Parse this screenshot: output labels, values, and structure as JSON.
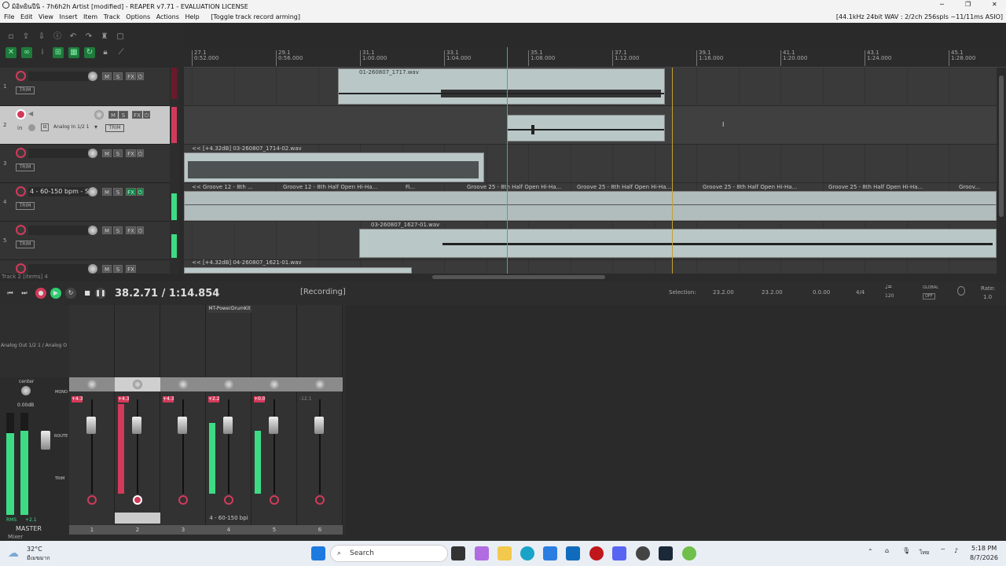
{
  "window": {
    "title": "มิอิทยินปีนิ - 7h6h2h Artist [modified] - REAPER v7.71 - EVALUATION LICENSE",
    "audio_info": "[44.1kHz 24bit WAV : 2/2ch 256spls ~11/11ms ASIO]"
  },
  "menu": {
    "items": [
      "File",
      "Edit",
      "View",
      "Insert",
      "Item",
      "Track",
      "Options",
      "Actions",
      "Help"
    ],
    "toggle_hint": "[Toggle track record arming]"
  },
  "ruler": {
    "marks": [
      {
        "bar": "27.1",
        "time": "0:52.000"
      },
      {
        "bar": "29.1",
        "time": "0:56.000"
      },
      {
        "bar": "31.1",
        "time": "1:00.000"
      },
      {
        "bar": "33.1",
        "time": "1:04.000"
      },
      {
        "bar": "35.1",
        "time": "1:08.000"
      },
      {
        "bar": "37.1",
        "time": "1:12.000"
      },
      {
        "bar": "39.1",
        "time": "1:16.000"
      },
      {
        "bar": "41.1",
        "time": "1:20.000"
      },
      {
        "bar": "43.1",
        "time": "1:24.000"
      },
      {
        "bar": "45.1",
        "time": "1:28.000"
      }
    ]
  },
  "tracks": [
    {
      "num": "1",
      "name": "",
      "input": ""
    },
    {
      "num": "2",
      "name": "",
      "input": "Analog In 1/2 1"
    },
    {
      "num": "3",
      "name": "",
      "input": ""
    },
    {
      "num": "4",
      "name": "4 - 60-150 bpm - S",
      "input": ""
    },
    {
      "num": "5",
      "name": "",
      "input": ""
    },
    {
      "num": "6",
      "name": "",
      "input": ""
    }
  ],
  "labels": {
    "m": "M",
    "s": "S",
    "fx": "FX",
    "trim": "TRIM",
    "in": "in"
  },
  "items": {
    "t1": "01-260807_1717.wav",
    "t3": "<< [+4.32dB] 03-260807_1714-02.wav",
    "t4": [
      "<< Groove 12 - 8th ...",
      "Groove 12 - 8th Half Open Hi-Ha...",
      "Fi...",
      "Groove 25 - 8th Half Open Hi-Ha...",
      "Groove 25 - 8th Half Open Hi-Ha...",
      "Groove 25 - 8th Half Open Hi-Ha...",
      "Groove 25 - 8th Half Open Hi-Ha...",
      "Groov..."
    ],
    "t5": "03-260807_1627-01.wav",
    "t6": "<< [+4.32dB] 04-260807_1621-01.wav"
  },
  "status": {
    "track_info": "Track 2 [items] 4",
    "time": "38.2.71 / 1:14.854",
    "rec_state": "[Recording]"
  },
  "selection": {
    "label": "Selection:",
    "start": "23.2.00",
    "end": "23.2.00",
    "length": "0.0.00",
    "time_sig": "4/4",
    "bpm": "120",
    "rate_label": "Rate:",
    "rate": "1.0",
    "global": "GLOBAL",
    "global_state": "OFF"
  },
  "mixer": {
    "master_label": "MASTER",
    "pan": "center",
    "master_vol": "0.00dB",
    "rms": "RMS",
    "rms_val": "+2.1",
    "out": "Analog Out 1/2 1 / Analog O",
    "fx_slot": "MT-PowerDrumKit",
    "mono": "MONO",
    "route": "ROUTE",
    "trim": "TRIM",
    "strips": [
      {
        "num": "1",
        "vol": "+4.3",
        "label": ""
      },
      {
        "num": "2",
        "vol": "+4.3",
        "label": ""
      },
      {
        "num": "3",
        "vol": "+4.3",
        "label": ""
      },
      {
        "num": "4",
        "vol": "+2.2",
        "label": "4 - 60-150 bpi"
      },
      {
        "num": "5",
        "vol": "+0.0",
        "label": ""
      },
      {
        "num": "6",
        "vol": "-12.1",
        "label": ""
      }
    ],
    "section_label": "Mixer"
  },
  "taskbar": {
    "weather_temp": "32°C",
    "weather_desc": "มีเมฆมาก",
    "search": "Search",
    "lang": "ไทย",
    "time": "5:18 PM",
    "date": "8/7/2026"
  },
  "colors": {
    "rec": "#d23a5a",
    "meter": "#3ddc84",
    "accent": "#1f7a3c",
    "item": "#b9c7c7"
  }
}
